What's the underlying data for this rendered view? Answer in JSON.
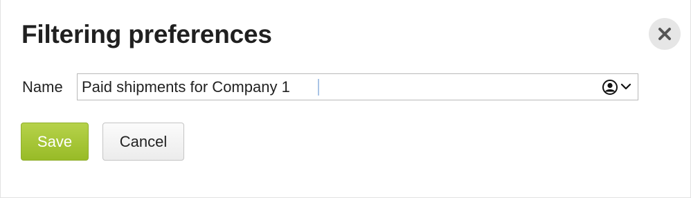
{
  "dialog": {
    "title": "Filtering preferences",
    "close_icon": "close-icon"
  },
  "form": {
    "name_label": "Name",
    "name_value": "Paid shipments for Company 1",
    "owner_icon": "user-circle-icon",
    "dropdown_icon": "chevron-down-icon"
  },
  "actions": {
    "save_label": "Save",
    "cancel_label": "Cancel"
  },
  "colors": {
    "save_button": "#a6c637",
    "save_text": "#ffffff",
    "cancel_button": "#f3f3f3",
    "close_button": "#e6e6e6"
  }
}
